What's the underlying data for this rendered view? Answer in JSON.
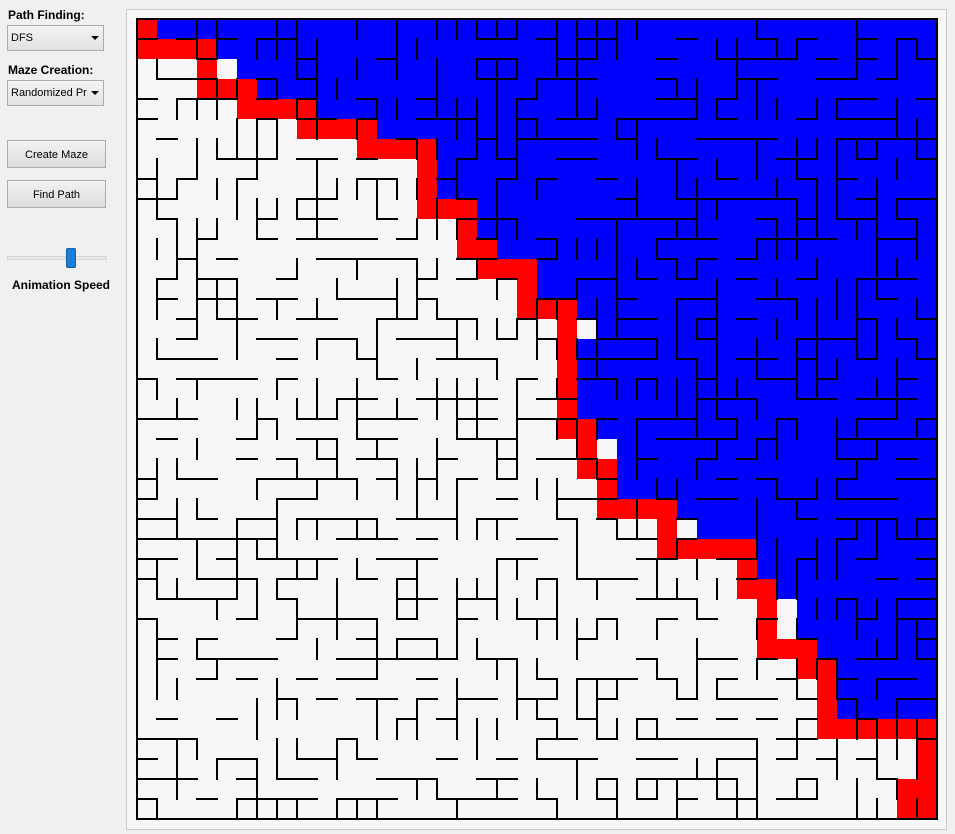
{
  "sidebar": {
    "path_finding_label": "Path Finding:",
    "path_finding_value": "DFS",
    "maze_creation_label": "Maze Creation:",
    "maze_creation_value": "Randomized Prim",
    "create_maze_button": "Create Maze",
    "find_path_button": "Find Path",
    "animation_speed_label": "Animation Speed",
    "animation_speed_fraction": 0.65
  },
  "maze": {
    "grid_columns": 40,
    "grid_rows": 40,
    "colors": {
      "unvisited": "#ffffff",
      "explored": "#0000ff",
      "path": "#ff0000",
      "wall": "#000000"
    }
  }
}
